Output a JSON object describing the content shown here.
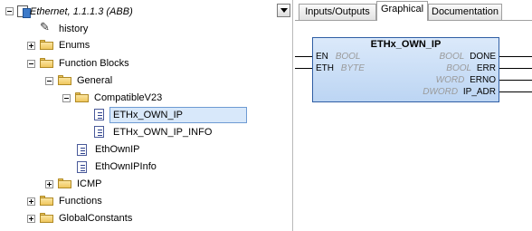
{
  "tree": {
    "root": "Ethernet, 1.1.1.3 (ABB)",
    "items": [
      {
        "label": "history"
      },
      {
        "label": "Enums"
      },
      {
        "label": "Function Blocks"
      },
      {
        "label": "General"
      },
      {
        "label": "CompatibleV23"
      },
      {
        "label": "ETHx_OWN_IP"
      },
      {
        "label": "ETHx_OWN_IP_INFO"
      },
      {
        "label": "EthOwnIP"
      },
      {
        "label": "EthOwnIPInfo"
      },
      {
        "label": "ICMP"
      },
      {
        "label": "Functions"
      },
      {
        "label": "GlobalConstants"
      }
    ]
  },
  "tabs": [
    "Inputs/Outputs",
    "Graphical",
    "Documentation"
  ],
  "fb": {
    "title": "ETHx_OWN_IP",
    "inputs": [
      {
        "name": "EN",
        "type": "BOOL"
      },
      {
        "name": "ETH",
        "type": "BYTE"
      }
    ],
    "outputs": [
      {
        "name": "DONE",
        "type": "BOOL"
      },
      {
        "name": "ERR",
        "type": "BOOL"
      },
      {
        "name": "ERNO",
        "type": "WORD"
      },
      {
        "name": "IP_ADR",
        "type": "DWORD"
      }
    ]
  }
}
